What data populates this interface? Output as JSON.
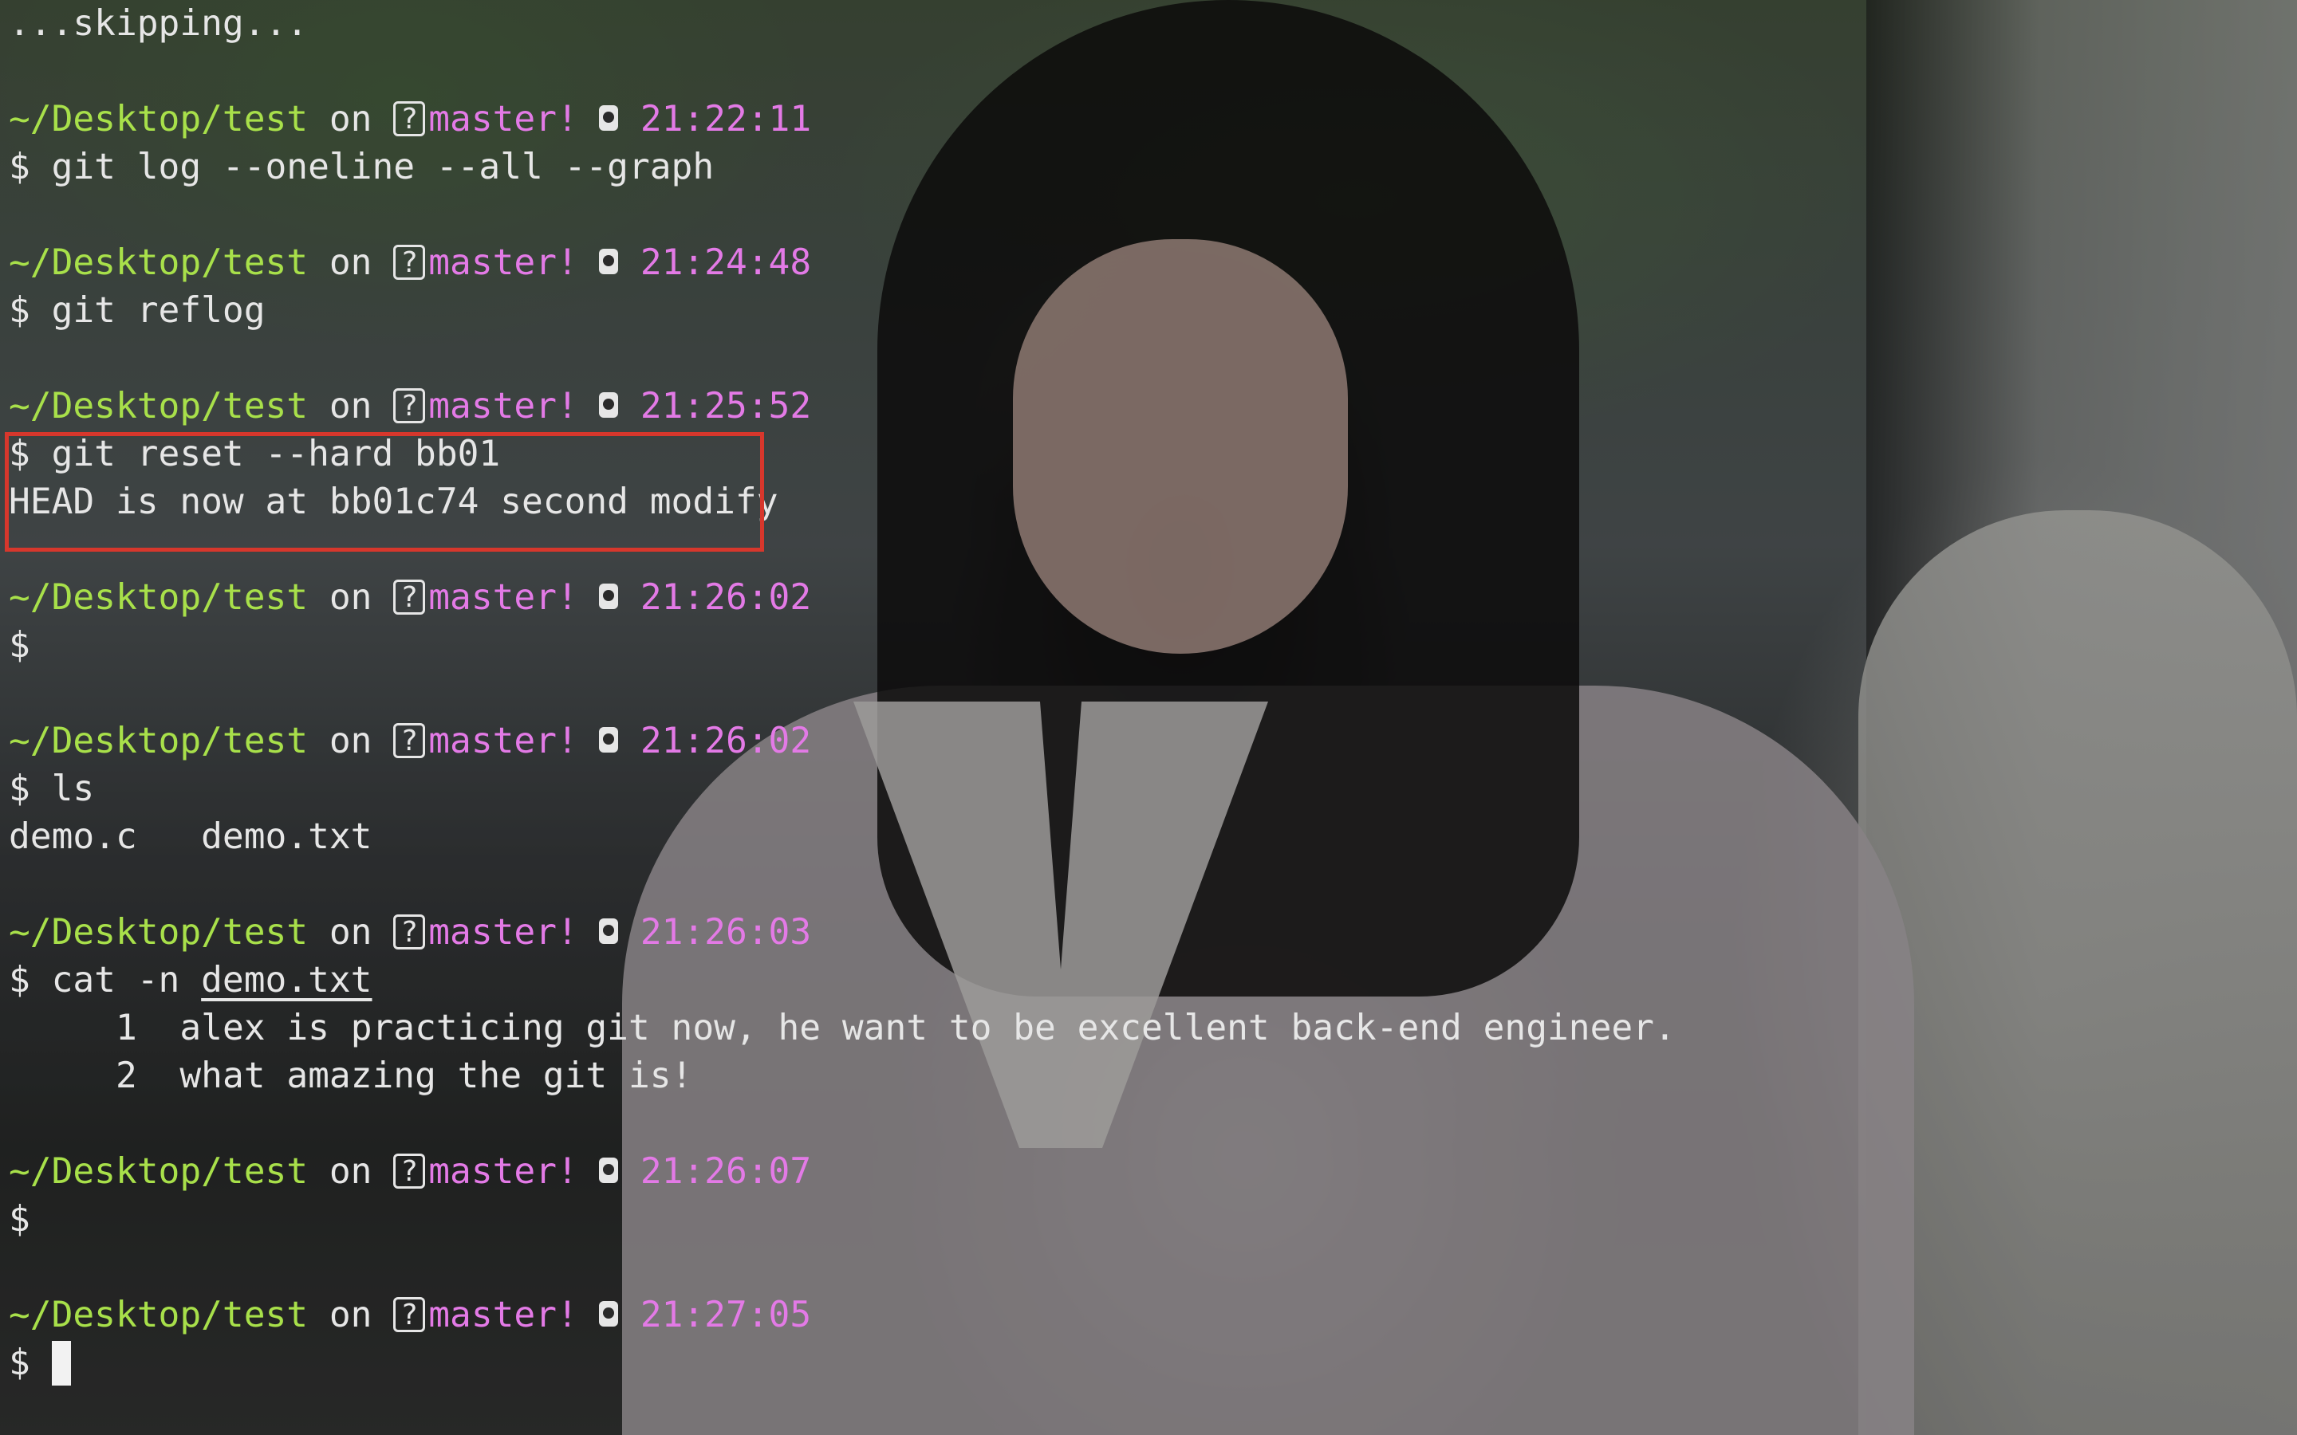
{
  "terminal": {
    "skip_line": "...skipping...",
    "prompt_symbol": "$",
    "prompt": {
      "path": "~/Desktop/test",
      "on": "on",
      "git_icon_glyph": "?",
      "branch": "master!"
    },
    "blocks": [
      {
        "time": "21:22:11",
        "command": "git log --oneline --all --graph"
      },
      {
        "time": "21:24:48",
        "command": "git reflog"
      },
      {
        "time": "21:25:52",
        "command": "git reset --hard bb01",
        "output": "HEAD is now at bb01c74 second modify"
      },
      {
        "time": "21:26:02",
        "command": ""
      },
      {
        "time": "21:26:02",
        "command": "ls",
        "output_files": [
          "demo.c",
          "demo.txt"
        ]
      },
      {
        "time": "21:26:03",
        "command_prefix": "cat -n ",
        "command_arg": "demo.txt",
        "output_lines": [
          {
            "num": "1",
            "text": "alex is practicing git now, he want to be excellent back-end engineer."
          },
          {
            "num": "2",
            "text": "what amazing the git is!"
          }
        ]
      },
      {
        "time": "21:26:07",
        "command": ""
      },
      {
        "time": "21:27:05",
        "command": ""
      }
    ]
  },
  "colors": {
    "path": "#a8e04a",
    "branch": "#e37ae6",
    "time": "#e37ae6",
    "text": "#e6e6e6",
    "highlight_border": "#d7372c"
  },
  "icons": {
    "git_status": "question-box-icon",
    "clock": "watch-icon"
  }
}
